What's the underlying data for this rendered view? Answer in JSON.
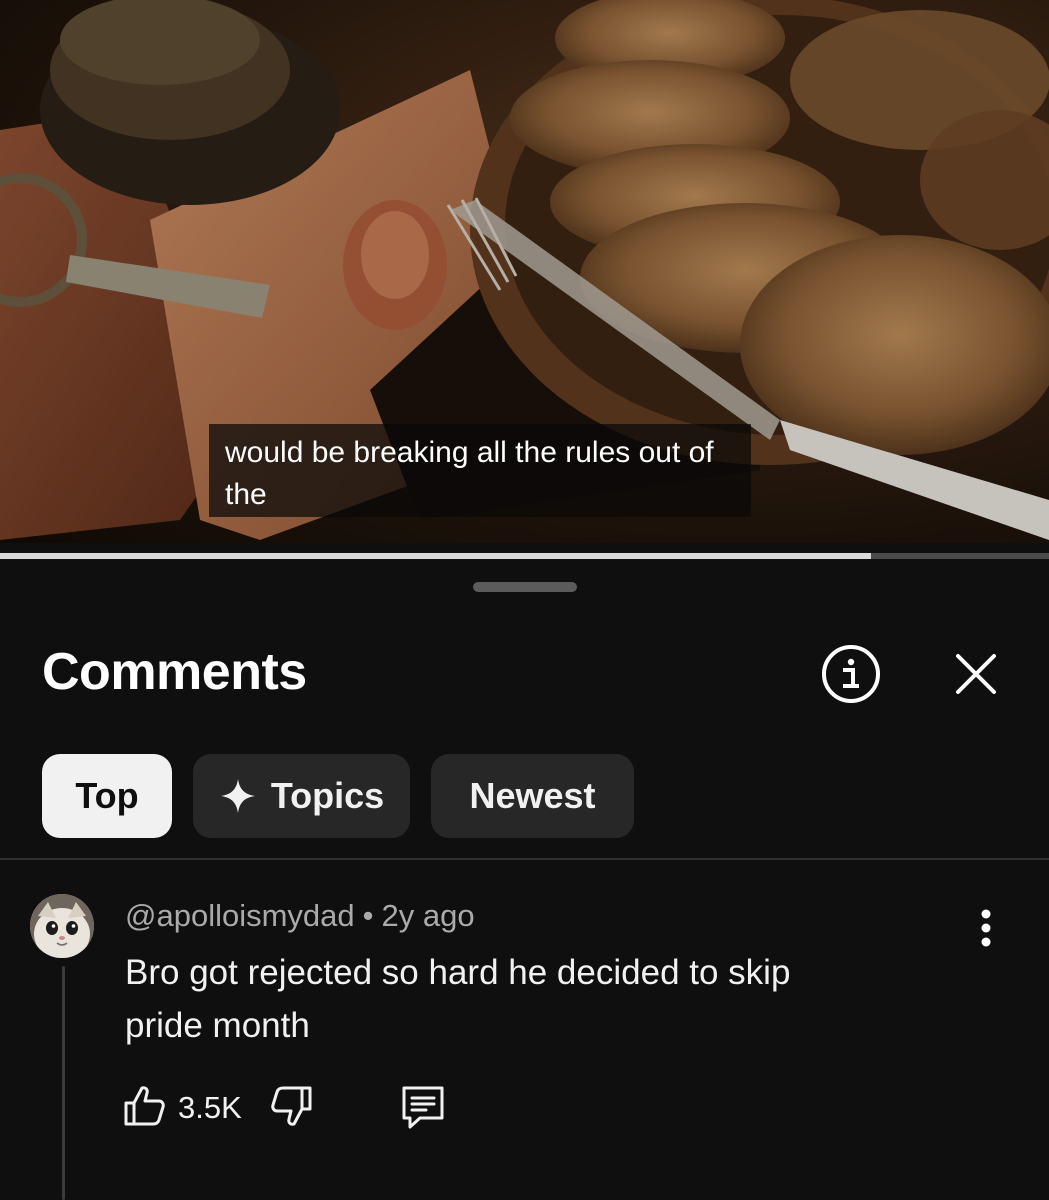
{
  "video": {
    "captions": [
      "would be breaking all the rules out of",
      "the"
    ],
    "progress": 0.83
  },
  "comments_panel": {
    "title": "Comments",
    "info_icon": "info-circle-icon",
    "close_icon": "close-icon",
    "filters": [
      {
        "label": "Top",
        "active": true
      },
      {
        "label": "Topics",
        "active": false,
        "icon": "sparkle-icon"
      },
      {
        "label": "Newest",
        "active": false
      }
    ]
  },
  "comment": {
    "author": "@apolloismydad",
    "separator": "•",
    "time": "2y ago",
    "text_lines": [
      "Bro got rejected so hard he decided to skip",
      "pride month"
    ],
    "likes": "3.5K",
    "like_icon": "thumbs-up-icon",
    "dislike_icon": "thumbs-down-icon",
    "reply_icon": "reply-icon",
    "more_icon": "more-vertical-icon"
  },
  "colors": {
    "background": "#0f0f0f",
    "chip_active_bg": "#f1f1f1",
    "chip_bg": "#272727",
    "secondary_text": "#aaaaaa"
  }
}
